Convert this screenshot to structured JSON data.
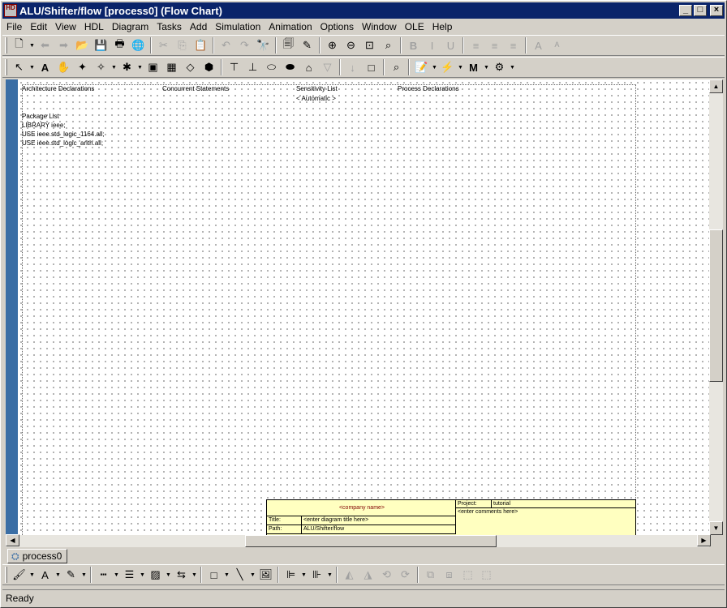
{
  "window": {
    "title": "ALU/Shifter/flow [process0] (Flow Chart)",
    "app_icon_label": "HD",
    "minimize_glyph": "_",
    "maximize_glyph": "□",
    "close_glyph": "×"
  },
  "menu": [
    "File",
    "Edit",
    "View",
    "HDL",
    "Diagram",
    "Tasks",
    "Add",
    "Simulation",
    "Animation",
    "Options",
    "Window",
    "OLE",
    "Help"
  ],
  "toolbar1": [
    {
      "name": "new-icon",
      "glyph": "🗋",
      "drop": true
    },
    {
      "name": "back-arrow-icon",
      "glyph": "⬅",
      "dis": true
    },
    {
      "name": "forward-arrow-icon",
      "glyph": "➡",
      "dis": true
    },
    {
      "name": "open-folder-icon",
      "glyph": "📂"
    },
    {
      "name": "save-icon",
      "glyph": "💾"
    },
    {
      "name": "print-icon",
      "glyph": "🖶"
    },
    {
      "name": "globe-icon",
      "glyph": "🌐"
    },
    {
      "sep": true
    },
    {
      "name": "cut-icon",
      "glyph": "✂",
      "dis": true
    },
    {
      "name": "copy-icon",
      "glyph": "⎘",
      "dis": true
    },
    {
      "name": "paste-icon",
      "glyph": "📋"
    },
    {
      "sep": true
    },
    {
      "name": "undo-icon",
      "glyph": "↶",
      "dis": true
    },
    {
      "name": "redo-icon",
      "glyph": "↷",
      "dis": true
    },
    {
      "name": "find-binoculars-icon",
      "glyph": "🔭"
    },
    {
      "sep": true
    },
    {
      "name": "properties-icon",
      "glyph": "🗐"
    },
    {
      "name": "edit-wand-icon",
      "glyph": "✎"
    },
    {
      "sep": true
    },
    {
      "name": "zoom-in-icon",
      "glyph": "⊕"
    },
    {
      "name": "zoom-out-icon",
      "glyph": "⊖"
    },
    {
      "name": "zoom-fit-icon",
      "glyph": "⊡"
    },
    {
      "name": "zoom-area-icon",
      "glyph": "⌕"
    },
    {
      "sep": true
    },
    {
      "name": "bold-icon",
      "glyph": "B",
      "dis": true,
      "bold": true
    },
    {
      "name": "italic-icon",
      "glyph": "I",
      "dis": true
    },
    {
      "name": "underline-icon",
      "glyph": "U",
      "dis": true
    },
    {
      "sep": true
    },
    {
      "name": "align-left-icon",
      "glyph": "≡",
      "dis": true
    },
    {
      "name": "align-center-icon",
      "glyph": "≡",
      "dis": true
    },
    {
      "name": "align-right-icon",
      "glyph": "≡",
      "dis": true
    },
    {
      "sep": true
    },
    {
      "name": "font-grow-icon",
      "glyph": "A",
      "dis": true
    },
    {
      "name": "font-shrink-icon",
      "glyph": "ᴬ",
      "dis": true
    }
  ],
  "toolbar2": [
    {
      "name": "select-pointer-icon",
      "glyph": "↖",
      "drop": true
    },
    {
      "name": "text-tool-icon",
      "glyph": "A",
      "bold": true
    },
    {
      "name": "pan-hand-icon",
      "glyph": "✋"
    },
    {
      "name": "add-start-icon",
      "glyph": "✦"
    },
    {
      "name": "add-signal-icon",
      "glyph": "✧",
      "drop": true
    },
    {
      "name": "add-action-icon",
      "glyph": "✱",
      "drop": true
    },
    {
      "name": "action-box-icon",
      "glyph": "▣"
    },
    {
      "name": "hierarchical-action-icon",
      "glyph": "▦"
    },
    {
      "name": "decision-icon",
      "glyph": "◇"
    },
    {
      "name": "end-point-icon",
      "glyph": "⬢"
    },
    {
      "sep": true
    },
    {
      "name": "loop-start-icon",
      "glyph": "⊤"
    },
    {
      "name": "loop-end-icon",
      "glyph": "⊥"
    },
    {
      "name": "wait-icon",
      "glyph": "⬭"
    },
    {
      "name": "case-icon",
      "glyph": "⬬"
    },
    {
      "name": "flow-arrow-icon",
      "glyph": "⌂"
    },
    {
      "name": "off-page-icon",
      "glyph": "▽",
      "dis": true
    },
    {
      "sep": true
    },
    {
      "name": "down-arrow-icon",
      "glyph": "↓",
      "dis": true
    },
    {
      "name": "rectangle-icon",
      "glyph": "□"
    },
    {
      "sep": true
    },
    {
      "name": "zoom-view-icon",
      "glyph": "⌕"
    },
    {
      "sep": true
    },
    {
      "name": "generate-hdl-icon",
      "glyph": "📝",
      "drop": true
    },
    {
      "name": "simulate-icon",
      "glyph": "⚡",
      "drop": true
    },
    {
      "name": "modelsim-icon",
      "glyph": "M",
      "bold": true,
      "drop": true
    },
    {
      "name": "synthesis-icon",
      "glyph": "⚙",
      "drop": true
    }
  ],
  "declarations": {
    "architecture": "Architecture Declarations",
    "concurrent": "Concurrent Statements",
    "sensitivity": "Sensitivity List",
    "sensitivity_value": "< Automatic >",
    "process": "Process Declarations",
    "package_title": "Package List",
    "package_lines": [
      "LIBRARY ieee;",
      "USE ieee.std_logic_1164.all;",
      "USE ieee.std_logic_arith.all;"
    ]
  },
  "titleblock": {
    "company": "<company name>",
    "project_label": "Project:",
    "project_value": "tutorial",
    "comments": "<enter comments here>",
    "title_label": "Title:",
    "title_value": "<enter diagram title here>",
    "path_label": "Path:",
    "path_value": "ALU/Shifter/flow"
  },
  "tabs": [
    {
      "label": "process0"
    }
  ],
  "toolbar3": [
    {
      "name": "fill-color-icon",
      "glyph": "🖌",
      "drop": true
    },
    {
      "name": "text-color-icon",
      "glyph": "A",
      "drop": true
    },
    {
      "name": "line-color-icon",
      "glyph": "✎",
      "drop": true
    },
    {
      "sep": true
    },
    {
      "name": "line-style-icon",
      "glyph": "┅",
      "drop": true
    },
    {
      "name": "line-width-icon",
      "glyph": "☰",
      "drop": true
    },
    {
      "name": "fill-pattern-icon",
      "glyph": "▨",
      "drop": true
    },
    {
      "name": "arrow-style-icon",
      "glyph": "⇆",
      "drop": true
    },
    {
      "sep": true
    },
    {
      "name": "box-shape-icon",
      "glyph": "□",
      "drop": true
    },
    {
      "name": "line-shape-icon",
      "glyph": "╲",
      "drop": true
    },
    {
      "name": "image-icon",
      "glyph": "🖼"
    },
    {
      "sep": true
    },
    {
      "name": "align-objects-icon",
      "glyph": "⊫",
      "drop": true
    },
    {
      "name": "distribute-icon",
      "glyph": "⊪",
      "drop": true
    },
    {
      "sep": true
    },
    {
      "name": "flip-horizontal-icon",
      "glyph": "◭",
      "dis": true
    },
    {
      "name": "flip-vertical-icon",
      "glyph": "◮",
      "dis": true
    },
    {
      "name": "rotate-left-icon",
      "glyph": "⟲",
      "dis": true
    },
    {
      "name": "rotate-right-icon",
      "glyph": "⟳",
      "dis": true
    },
    {
      "sep": true
    },
    {
      "name": "bring-front-icon",
      "glyph": "⧉",
      "dis": true
    },
    {
      "name": "send-back-icon",
      "glyph": "⧈",
      "dis": true
    },
    {
      "name": "group-icon",
      "glyph": "⬚",
      "dis": true
    },
    {
      "name": "ungroup-icon",
      "glyph": "⬚",
      "dis": true
    }
  ],
  "status": {
    "text": "Ready"
  }
}
